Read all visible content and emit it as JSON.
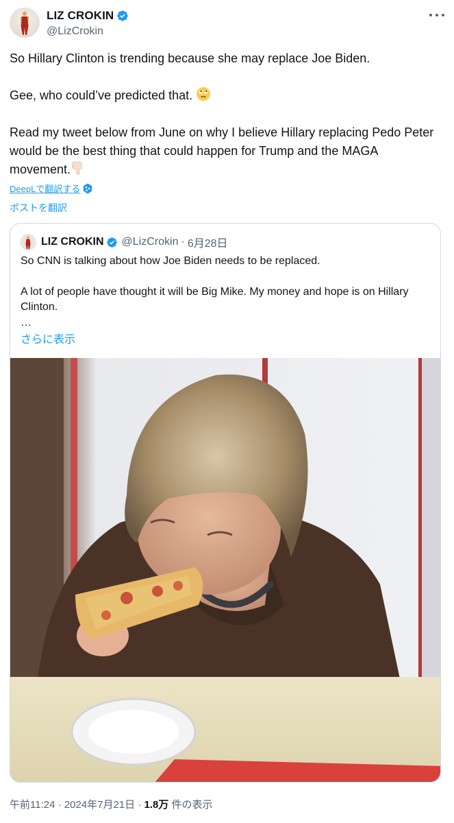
{
  "author": {
    "display_name": "LIZ CROKIN",
    "handle": "@LizCrokin",
    "verified": true
  },
  "tweet": {
    "line1": "So Hillary Clinton is trending because she may replace Joe Biden.",
    "line2": "Gee, who could’ve predicted that. ",
    "line3": "Read my tweet below from June on why I believe Hillary replacing Pedo Peter would be the best thing that could happen for Trump and the MAGA movement.",
    "emoji_1": "face-with-rolling-eyes",
    "emoji_2": "backhand-index-pointing-down"
  },
  "deepl_label": "DeepLで翻訳する",
  "translate_label": "ポストを翻訳",
  "quoted": {
    "display_name": "LIZ CROKIN",
    "handle": "@LizCrokin",
    "separator": "·",
    "date": "6月28日",
    "line1": "So CNN is talking about how Joe Biden needs to be replaced.",
    "line2": "A lot of people have thought it will be Big Mike. My money and hope is on Hillary Clinton.",
    "ellipsis": "…",
    "show_more": "さらに表示",
    "image_alt": "photo of a woman eating a slice of pizza"
  },
  "footer": {
    "time": "午前11:24",
    "sep1": " · ",
    "date": "2024年7月21日",
    "sep2": " · ",
    "views": "1.8万",
    "views_label": " 件の表示"
  },
  "colors": {
    "accent": "#1d9bf0",
    "secondary_text": "#536471",
    "border": "#cfd9de",
    "verified": "#1d9bf0"
  }
}
